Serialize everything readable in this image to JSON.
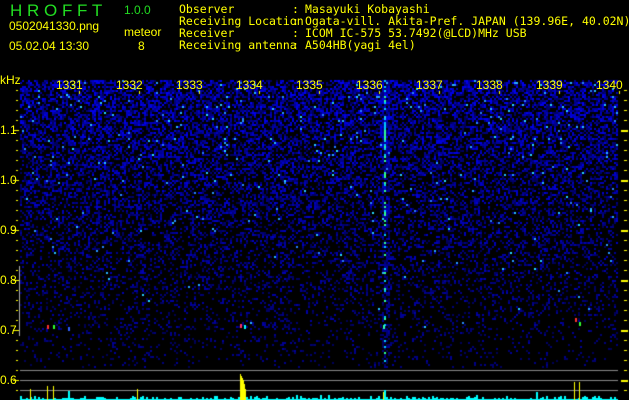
{
  "app": {
    "name": "H R O F F T",
    "version": "1.0.0"
  },
  "file": {
    "name": "0502041330.png",
    "datetime": "05.02.04 13:30"
  },
  "meteor": {
    "label": "meteor",
    "count": "8"
  },
  "info": [
    {
      "label": "Observer",
      "value": "Masayuki Kobayashi"
    },
    {
      "label": "Receiving Location",
      "value": "Ogata-vill. Akita-Pref. JAPAN (139.96E, 40.02N)"
    },
    {
      "label": "Receiver",
      "value": "ICOM IC-575 53.7492(@LCD)MHz USB"
    },
    {
      "label": "Receiving antenna",
      "value": "A504HB(yagi 4el)"
    }
  ],
  "spectrogram": {
    "y_unit": "kHz",
    "y_ticks": [
      "1.1",
      "1.0",
      "0.9",
      "0.8",
      "0.7",
      "0.6"
    ],
    "x_ticks": [
      "1331",
      "1332",
      "1333",
      "1334",
      "1335",
      "1336",
      "1337",
      "1338",
      "1339",
      "1340"
    ],
    "colors": {
      "noise": "#2233ff",
      "text": "#ffff00",
      "level": "#00ffff",
      "spike": "#ffff00",
      "grid": "#888888"
    }
  }
}
